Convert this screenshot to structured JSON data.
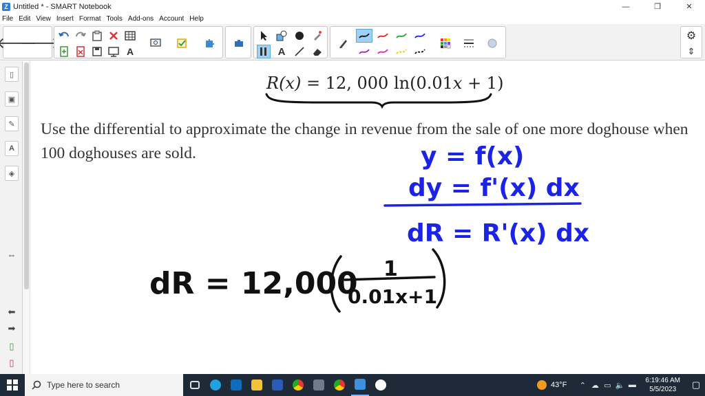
{
  "window": {
    "title": "Untitled * - SMART Notebook",
    "app_icon_glyph": "Z",
    "minimize_glyph": "—",
    "restore_glyph": "❐",
    "close_glyph": "✕"
  },
  "menu": [
    "File",
    "Edit",
    "View",
    "Insert",
    "Format",
    "Tools",
    "Add-ons",
    "Account",
    "Help"
  ],
  "toolbar": {
    "back_glyph": "🡐",
    "forward_glyph": "🡒",
    "text_tool_glyph": "A",
    "text_tool_small_glyph": "A",
    "settings_glyph": "⚙",
    "move_glyph": "⇕"
  },
  "sidebar": {
    "page_sorter_glyph": "▯",
    "gallery_glyph": "▣",
    "attachments_glyph": "✎",
    "properties_glyph": "A",
    "addons_glyph": "◈",
    "resize_glyph": "⇔",
    "prev_glyph": "⬅",
    "next_glyph": "➡",
    "add_page_glyph": "▯",
    "delete_page_glyph": "▯"
  },
  "page": {
    "formula_lhs": "R(x)",
    "formula_eq": " = 12, 000 ln(0.01",
    "formula_var": "x",
    "formula_tail": " + 1)",
    "problem_text": "Use the differential to approximate the change in revenue from the sale of one more doghouse when 100 doghouses are sold.",
    "handwriting": {
      "line1": "y = f(x)",
      "line2": "dy = f'(x) dx",
      "line3": "dR = R'(x) dx",
      "line4_prefix": "dR = 12,000",
      "numerator": "1",
      "denominator": "0.01x+1"
    }
  },
  "taskbar": {
    "search_placeholder": "Type here to search",
    "weather": "43°F",
    "time": "6:19:46 AM",
    "date": "5/5/2023"
  },
  "colors": {
    "ink_blue": "#1b24e6",
    "ink_black": "#111111",
    "taskbar": "#1e2a38"
  }
}
